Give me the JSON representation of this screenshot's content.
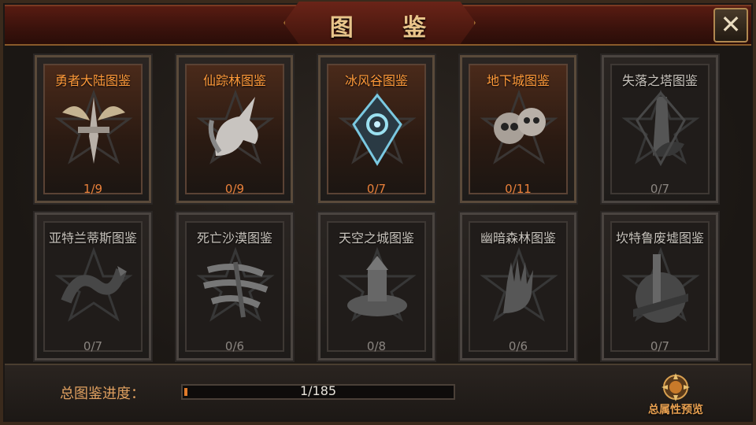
{
  "title": "图 鉴",
  "close_icon": "close-icon",
  "cards": [
    {
      "name": "勇者大陆图鉴",
      "count": "1/9",
      "active": true,
      "icon": "sword-wings-icon"
    },
    {
      "name": "仙踪林图鉴",
      "count": "0/9",
      "active": true,
      "icon": "unicorn-icon"
    },
    {
      "name": "冰风谷图鉴",
      "count": "0/7",
      "active": true,
      "icon": "ice-crest-icon"
    },
    {
      "name": "地下城图鉴",
      "count": "0/11",
      "active": true,
      "icon": "skulls-icon"
    },
    {
      "name": "失落之塔图鉴",
      "count": "0/7",
      "active": false,
      "icon": "tower-icon"
    },
    {
      "name": "亚特兰蒂斯图鉴",
      "count": "0/7",
      "active": false,
      "icon": "serpent-icon"
    },
    {
      "name": "死亡沙漠图鉴",
      "count": "0/6",
      "active": false,
      "icon": "sandstorm-icon"
    },
    {
      "name": "天空之城图鉴",
      "count": "0/8",
      "active": false,
      "icon": "cloud-castle-icon"
    },
    {
      "name": "幽暗森林图鉴",
      "count": "0/6",
      "active": false,
      "icon": "dark-hand-icon"
    },
    {
      "name": "坎特鲁废墟图鉴",
      "count": "0/7",
      "active": false,
      "icon": "ruins-icon"
    }
  ],
  "progress": {
    "label": "总图鉴进度：",
    "text": "1/185",
    "value": 1,
    "total": 185
  },
  "preview": {
    "label": "总属性预览",
    "icon": "attribute-emblem-icon"
  },
  "colors": {
    "accent": "#ff9a3a",
    "count_active": "#e9803a",
    "title": "#e8c48a",
    "bar_fill": "#e07a2a"
  }
}
